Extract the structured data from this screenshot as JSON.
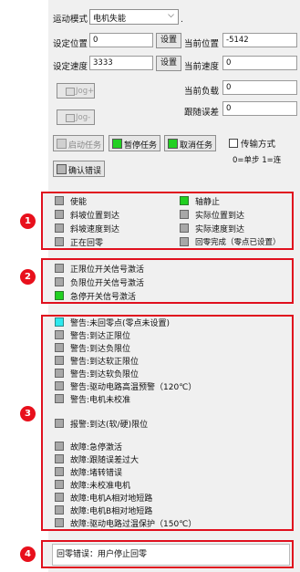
{
  "controls": {
    "mode_label": "运动模式",
    "mode_value": "电机失能",
    "set_pos_label": "设定位置",
    "set_pos_value": "0",
    "set_pos_btn": "设置",
    "cur_pos_label": "当前位置",
    "cur_pos_value": "-5142",
    "set_speed_label": "设定速度",
    "set_speed_value": "3333",
    "set_speed_btn": "设置",
    "cur_speed_label": "当前速度",
    "cur_speed_value": "0",
    "cur_load_label": "当前负载",
    "cur_load_value": "0",
    "follow_err_label": "跟随误差",
    "follow_err_value": "0",
    "jog_plus": "Jog+",
    "jog_minus": "Jog-",
    "start_task": "启动任务",
    "pause_task": "暂停任务",
    "cancel_task": "取消任务",
    "transfer_mode": "传输方式",
    "transfer_hint": "0=单步 1=连",
    "confirm_error": "确认错误"
  },
  "section1": {
    "badge": "1",
    "left": [
      {
        "label": "使能",
        "state": "off"
      },
      {
        "label": "斜坡位置到达",
        "state": "off"
      },
      {
        "label": "斜坡速度到达",
        "state": "off"
      },
      {
        "label": "正在回零",
        "state": "off"
      }
    ],
    "right": [
      {
        "label": "轴静止",
        "state": "green"
      },
      {
        "label": "实际位置到达",
        "state": "off"
      },
      {
        "label": "实际速度到达",
        "state": "off"
      },
      {
        "label": "回零完成（零点已设置）",
        "state": "off"
      }
    ]
  },
  "section2": {
    "badge": "2",
    "items": [
      {
        "label": "正限位开关信号激活",
        "state": "off"
      },
      {
        "label": "负限位开关信号激活",
        "state": "off"
      },
      {
        "label": "急停开关信号激活",
        "state": "green"
      }
    ]
  },
  "section3": {
    "badge": "3",
    "items": [
      {
        "label": "警告:未回零点(零点未设置)",
        "state": "cyan"
      },
      {
        "label": "警告:到达正限位",
        "state": "off"
      },
      {
        "label": "警告:到达负限位",
        "state": "off"
      },
      {
        "label": "警告:到达软正限位",
        "state": "off"
      },
      {
        "label": "警告:到达软负限位",
        "state": "off"
      },
      {
        "label": "警告:驱动电路高温预警（120℃）",
        "state": "off"
      },
      {
        "label": "警告:电机未校准",
        "state": "off"
      },
      {
        "label": "报警:到达(软/硬)限位",
        "state": "off"
      },
      {
        "label": "故障:急停激活",
        "state": "off"
      },
      {
        "label": "故障:跟随误差过大",
        "state": "off"
      },
      {
        "label": "故障:堵转错误",
        "state": "off"
      },
      {
        "label": "故障:未校准电机",
        "state": "off"
      },
      {
        "label": "故障:电机A相对地短路",
        "state": "off"
      },
      {
        "label": "故障:电机B相对地短路",
        "state": "off"
      },
      {
        "label": "故障:驱动电路过温保护（150℃）",
        "state": "off"
      }
    ]
  },
  "section4": {
    "badge": "4",
    "message": "回零错误：用户停止回零"
  }
}
